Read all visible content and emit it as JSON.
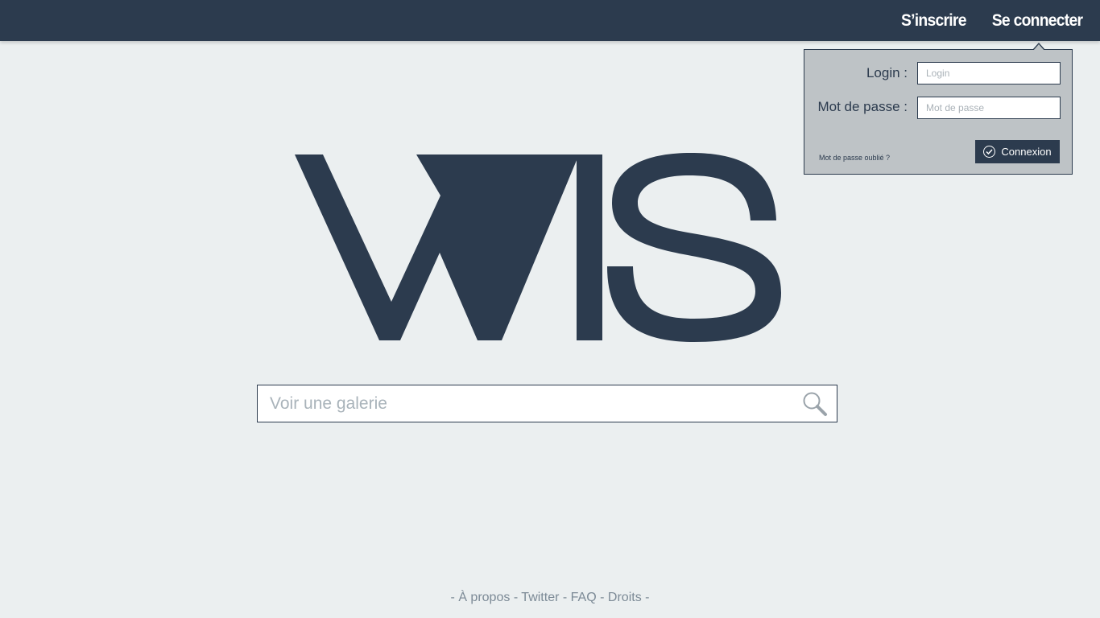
{
  "header": {
    "signup_label": "S’inscrire",
    "login_label": "Se connecter"
  },
  "login_popup": {
    "login_label": "Login :",
    "login_placeholder": "Login",
    "password_label": "Mot de passe :",
    "password_placeholder": "Mot de passe",
    "forgot_label": "Mot de passe oublié ?",
    "submit_label": "Connexion"
  },
  "logo": {
    "text": "WIS"
  },
  "search": {
    "placeholder": "Voir une galerie"
  },
  "footer": {
    "separator": "-",
    "links": [
      "À propos",
      "Twitter",
      "FAQ",
      "Droits"
    ]
  },
  "colors": {
    "primary": "#2c3b4e",
    "background": "#ebeff0",
    "popup_background": "#bec3c6",
    "footer_text": "#7c8a96"
  }
}
